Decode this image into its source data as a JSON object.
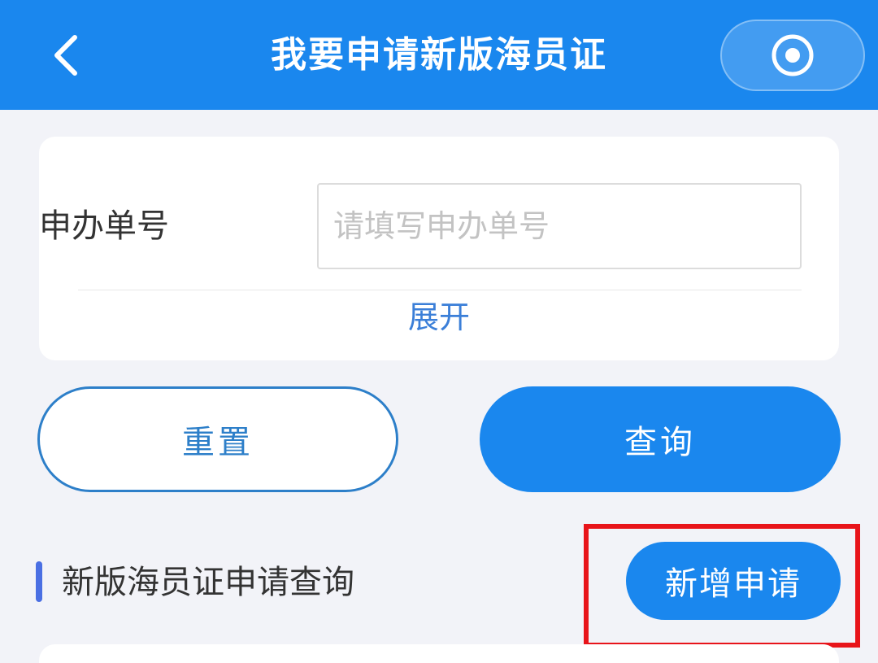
{
  "header": {
    "title": "我要申请新版海员证",
    "back_icon": "chevron-left-icon",
    "capsule_icon": "record-circle-icon",
    "background_color": "#1a87ee"
  },
  "form": {
    "order_label": "申办单号",
    "order_placeholder": "请填写申办单号",
    "order_value": "",
    "expand_label": "展开"
  },
  "actions": {
    "reset_label": "重置",
    "query_label": "查询"
  },
  "section": {
    "title": "新版海员证申请查询",
    "new_application_label": "新增申请"
  },
  "colors": {
    "primary": "#1a87ee",
    "link": "#3b7fd8",
    "highlight": "#e8141a",
    "background": "#f2f3f8"
  }
}
